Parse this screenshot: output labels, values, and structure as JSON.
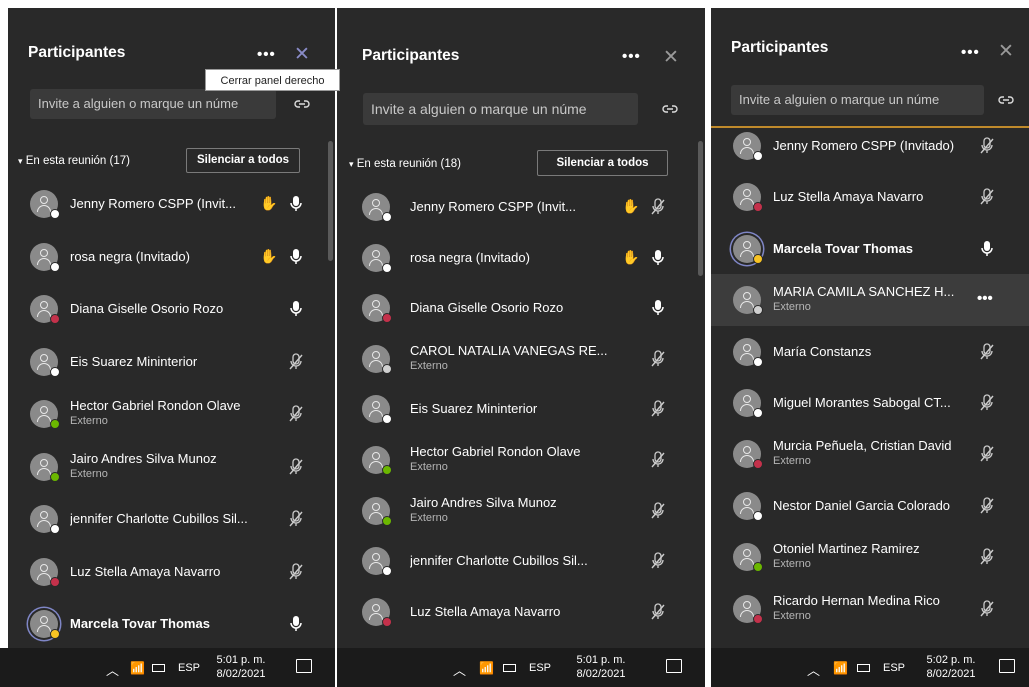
{
  "tooltip": "Cerrar panel derecho",
  "panels": [
    {
      "title": "Participantes",
      "invite_placeholder": "Invite a alguien o marque un núme",
      "section_label": "En esta reunión (17)",
      "mute_all": "Silenciar a todos",
      "participants": [
        {
          "name": "Jenny Romero CSPP (Invit...",
          "sub": "",
          "status": "white",
          "hand": true,
          "mic": "on"
        },
        {
          "name": "rosa negra (Invitado)",
          "sub": "",
          "status": "white",
          "hand": true,
          "mic": "on"
        },
        {
          "name": "Diana Giselle Osorio Rozo",
          "sub": "",
          "status": "red",
          "hand": false,
          "mic": "on"
        },
        {
          "name": "Eis Suarez Mininterior",
          "sub": "",
          "status": "white",
          "hand": false,
          "mic": "off"
        },
        {
          "name": "Hector Gabriel Rondon Olave",
          "sub": "Externo",
          "status": "green",
          "hand": false,
          "mic": "off"
        },
        {
          "name": "Jairo Andres Silva Munoz",
          "sub": "Externo",
          "status": "green",
          "hand": false,
          "mic": "off"
        },
        {
          "name": "jennifer Charlotte Cubillos Sil...",
          "sub": "",
          "status": "white",
          "hand": false,
          "mic": "off"
        },
        {
          "name": "Luz Stella Amaya Navarro",
          "sub": "",
          "status": "red",
          "hand": false,
          "mic": "off"
        },
        {
          "name": "Marcela Tovar Thomas",
          "sub": "",
          "status": "yellow",
          "hand": false,
          "mic": "on",
          "bold": true,
          "ring": true
        }
      ],
      "taskbar": {
        "lang": "ESP",
        "time": "5:01 p. m.",
        "date": "8/02/2021"
      }
    },
    {
      "title": "Participantes",
      "invite_placeholder": "Invite a alguien o marque un núme",
      "section_label": "En esta reunión (18)",
      "mute_all": "Silenciar a todos",
      "participants": [
        {
          "name": "Jenny Romero CSPP (Invit...",
          "sub": "",
          "status": "white",
          "hand": true,
          "mic": "off"
        },
        {
          "name": "rosa negra (Invitado)",
          "sub": "",
          "status": "white",
          "hand": true,
          "mic": "on"
        },
        {
          "name": "Diana Giselle Osorio Rozo",
          "sub": "",
          "status": "red",
          "hand": false,
          "mic": "on"
        },
        {
          "name": "CAROL NATALIA VANEGAS RE...",
          "sub": "Externo",
          "status": "ext",
          "hand": false,
          "mic": "off"
        },
        {
          "name": "Eis Suarez Mininterior",
          "sub": "",
          "status": "white",
          "hand": false,
          "mic": "off"
        },
        {
          "name": "Hector Gabriel Rondon Olave",
          "sub": "Externo",
          "status": "green",
          "hand": false,
          "mic": "off"
        },
        {
          "name": "Jairo Andres Silva Munoz",
          "sub": "Externo",
          "status": "green",
          "hand": false,
          "mic": "off"
        },
        {
          "name": "jennifer Charlotte Cubillos Sil...",
          "sub": "",
          "status": "white",
          "hand": false,
          "mic": "off"
        },
        {
          "name": "Luz Stella Amaya Navarro",
          "sub": "",
          "status": "red",
          "hand": false,
          "mic": "off"
        }
      ],
      "taskbar": {
        "lang": "ESP",
        "time": "5:01 p. m.",
        "date": "8/02/2021"
      }
    },
    {
      "title": "Participantes",
      "invite_placeholder": "Invite a alguien o marque un núme",
      "participants": [
        {
          "name": "Jenny Romero CSPP (Invitado)",
          "sub": "",
          "status": "white",
          "hand": false,
          "mic": "off"
        },
        {
          "name": "Luz Stella Amaya Navarro",
          "sub": "",
          "status": "red",
          "hand": false,
          "mic": "off"
        },
        {
          "name": "Marcela Tovar Thomas",
          "sub": "",
          "status": "yellow",
          "hand": false,
          "mic": "on",
          "bold": true,
          "ring": true
        },
        {
          "name": "MARIA CAMILA SANCHEZ H...",
          "sub": "Externo",
          "status": "ext",
          "hand": false,
          "mic": "dots",
          "highlight": true
        },
        {
          "name": "María Constanzs",
          "sub": "",
          "status": "white",
          "hand": false,
          "mic": "off"
        },
        {
          "name": "Miguel Morantes Sabogal CT...",
          "sub": "",
          "status": "white",
          "hand": false,
          "mic": "off"
        },
        {
          "name": "Murcia Peñuela, Cristian David",
          "sub": "Externo",
          "status": "red",
          "hand": false,
          "mic": "off"
        },
        {
          "name": "Nestor Daniel Garcia Colorado",
          "sub": "",
          "status": "white",
          "hand": false,
          "mic": "off"
        },
        {
          "name": "Otoniel Martinez Ramirez",
          "sub": "Externo",
          "status": "green",
          "hand": false,
          "mic": "off"
        },
        {
          "name": "Ricardo Hernan Medina Rico",
          "sub": "Externo",
          "status": "red",
          "hand": false,
          "mic": "off"
        }
      ],
      "taskbar": {
        "lang": "ESP",
        "time": "5:02 p. m.",
        "date": "8/02/2021"
      }
    }
  ],
  "colors": {
    "panel_bg": "#292929",
    "accent": "#7f86c6",
    "raise_hand": "#f7b500",
    "divider": "#c08a2b"
  },
  "icons": {
    "more": "more-options-icon",
    "close": "close-icon",
    "link": "link-icon",
    "hand": "raised-hand-icon",
    "mic_on": "microphone-icon",
    "mic_off": "microphone-off-icon"
  }
}
